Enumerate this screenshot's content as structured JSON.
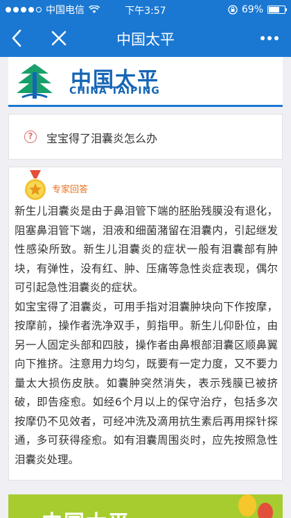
{
  "status_bar": {
    "carrier": "中国电信",
    "time": "下午3:57",
    "battery": "69%",
    "battery_level": 0.69,
    "signal_icon": "signal-dots-icon",
    "wifi_icon": "wifi-icon",
    "rotation_lock_icon": "rotation-lock-icon"
  },
  "nav": {
    "title": "中国太平",
    "back_icon": "chevron-left-icon",
    "close_icon": "close-icon",
    "more_icon": "more-dots-icon"
  },
  "logo": {
    "cn": "中国太平",
    "en": "CHINA TAIPING"
  },
  "question": {
    "text": "宝宝得了泪囊炎怎么办",
    "icon": "question-icon"
  },
  "answer": {
    "label": "专家回答",
    "paragraphs": [
      "新生儿泪囊炎是由于鼻泪管下端的胚胎残膜没有退化，阻塞鼻泪管下端，泪液和细菌潴留在泪囊内，引起继发性感染所致。新生儿泪囊炎的症状一般有泪囊部有肿块，有弹性，没有红、肿、压痛等急性炎症表现，偶尔可引起急性泪囊炎的症状。",
      "如宝宝得了泪囊炎，可用手指对泪囊肿块向下作按摩，按摩前，操作者洗净双手，剪指甲。新生儿仰卧位，由另一人固定头部和四肢，操作者由鼻根部泪囊区顺鼻翼向下推挤。注意用力均匀，既要有一定力度，又不要力量太大损伤皮肤。如囊肿突然消失，表示残膜已被挤破，即告痊愈。如经6个月以上的保守治疗，包括多次按摩仍不见效者，可经冲洗及滴用抗生素后再用探针探通，多可获得痊愈。如有泪囊周围炎时，应先按照急性泪囊炎处理。"
    ]
  },
  "banner": {
    "text": "中国太平"
  },
  "colors": {
    "brand_blue": "#1a78d2",
    "accent_orange": "#e8701a",
    "banner_green": "#a6cc30"
  }
}
